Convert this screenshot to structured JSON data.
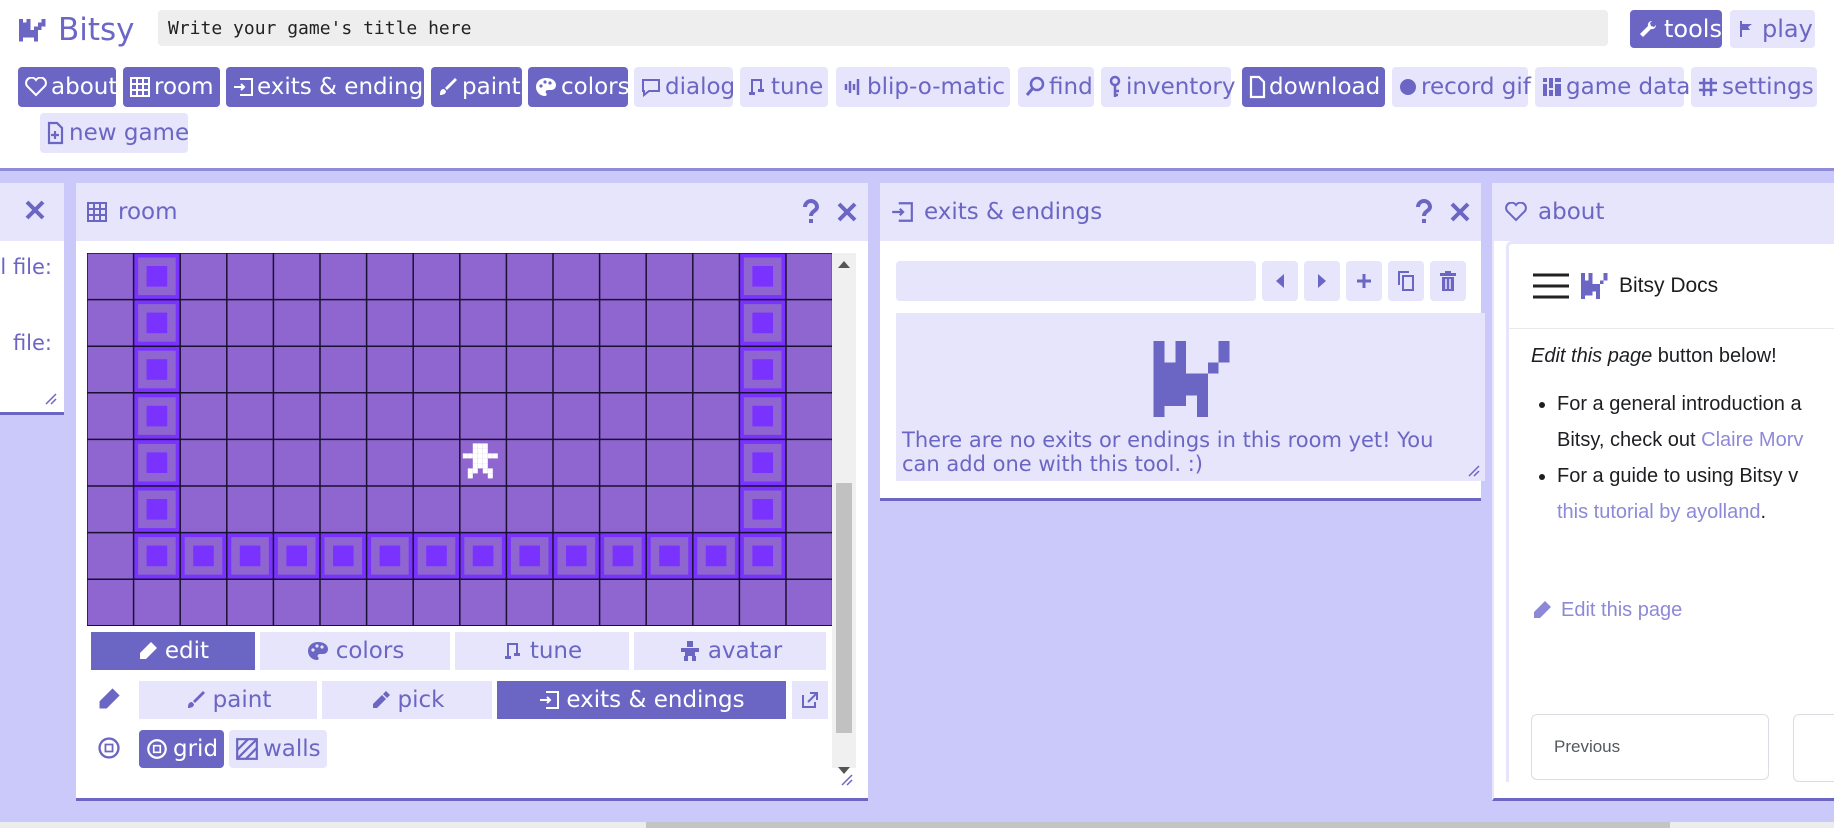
{
  "app": {
    "name": "Bitsy"
  },
  "title_input": {
    "placeholder": "Write your game's title here"
  },
  "modes": {
    "tools": "tools",
    "play": "play"
  },
  "nav": {
    "about": "about",
    "room": "room",
    "exits": "exits & endings",
    "paint": "paint",
    "colors": "colors",
    "dialog": "dialog",
    "tune": "tune",
    "blip": "blip-o-matic",
    "find": "find",
    "inventory": "inventory",
    "download": "download",
    "record": "record gif",
    "gamedata": "game data",
    "settings": "settings",
    "newgame": "new game"
  },
  "left_card": {
    "label1": "al file:",
    "label2": "file:"
  },
  "room_card": {
    "title": "room",
    "tabs": [
      "edit",
      "colors",
      "tune",
      "avatar"
    ],
    "tools": [
      "paint",
      "pick",
      "exits & endings"
    ],
    "toggles": {
      "grid": "grid",
      "walls": "walls"
    }
  },
  "exits_card": {
    "title": "exits & endings",
    "empty_message": "There are no exits or endings in this room yet! You can add one with this tool. :)"
  },
  "about_card": {
    "title": "about",
    "docs_title": "Bitsy Docs",
    "edit_line_em": "Edit this page",
    "edit_line_rest": " button below!",
    "bullet1_text": "For a general introduction a",
    "bullet1_text2": "Bitsy, check out ",
    "bullet1_link": "Claire Morv",
    "bullet2_text": "For a guide to using Bitsy v",
    "bullet2_link": "this tutorial by ayolland",
    "bullet2_end": ".",
    "edit_link": "Edit this page",
    "previous": "Previous"
  },
  "colors": {
    "accent": "#6b66c4",
    "room_bg": "#8f65cf",
    "wall": "#7a33ff",
    "workspace": "#cac9fa"
  }
}
